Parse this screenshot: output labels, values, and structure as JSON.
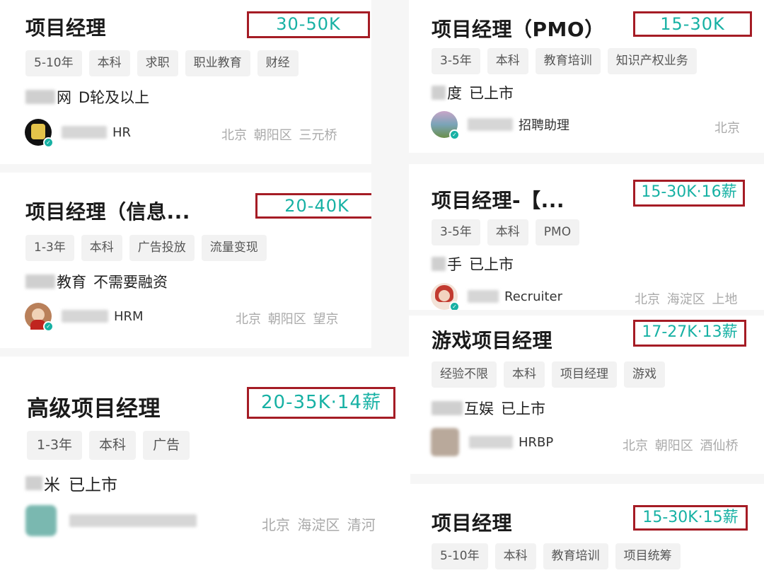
{
  "left": [
    {
      "title": "项目经理",
      "salary": "30-50K",
      "tags": [
        "5-10年",
        "本科",
        "求职",
        "职业教育",
        "财经"
      ],
      "company_visible": "网",
      "company_info": "D轮及以上",
      "recruiter_role": "HR",
      "location": "北京 朝阳区 三元桥"
    },
    {
      "title": "项目经理（信息...",
      "salary": "20-40K",
      "tags": [
        "1-3年",
        "本科",
        "广告投放",
        "流量变现"
      ],
      "company_visible": "教育",
      "company_info": "不需要融资",
      "recruiter_role": "HRM",
      "location": "北京 朝阳区 望京"
    },
    {
      "title": "高级项目经理",
      "salary": "20-35K·14薪",
      "tags": [
        "1-3年",
        "本科",
        "广告"
      ],
      "company_visible": "米",
      "company_info": "已上市",
      "recruiter_role": "",
      "location": "北京 海淀区 清河"
    }
  ],
  "right": [
    {
      "title": "项目经理（PMO）",
      "salary": "15-30K",
      "tags": [
        "3-5年",
        "本科",
        "教育培训",
        "知识产权业务"
      ],
      "company_visible": "度",
      "company_info": "已上市",
      "recruiter_role": "招聘助理",
      "location": "北京"
    },
    {
      "title": "项目经理-【...",
      "salary": "15-30K·16薪",
      "tags": [
        "3-5年",
        "本科",
        "PMO"
      ],
      "company_visible": "手",
      "company_info": "已上市",
      "recruiter_role": "Recruiter",
      "location": "北京 海淀区 上地"
    },
    {
      "title": "游戏项目经理",
      "salary": "17-27K·13薪",
      "tags": [
        "经验不限",
        "本科",
        "项目经理",
        "游戏"
      ],
      "company_visible": "互娱",
      "company_info": "已上市",
      "recruiter_role": "HRBP",
      "location": "北京 朝阳区 酒仙桥"
    },
    {
      "title": "项目经理",
      "salary": "15-30K·15薪",
      "tags": [
        "5-10年",
        "本科",
        "教育培训",
        "项目统筹"
      ]
    }
  ],
  "colors": {
    "salary_text": "#17b1a4",
    "highlight_box": "#a51c25",
    "verified_badge": "#17b1a4"
  }
}
